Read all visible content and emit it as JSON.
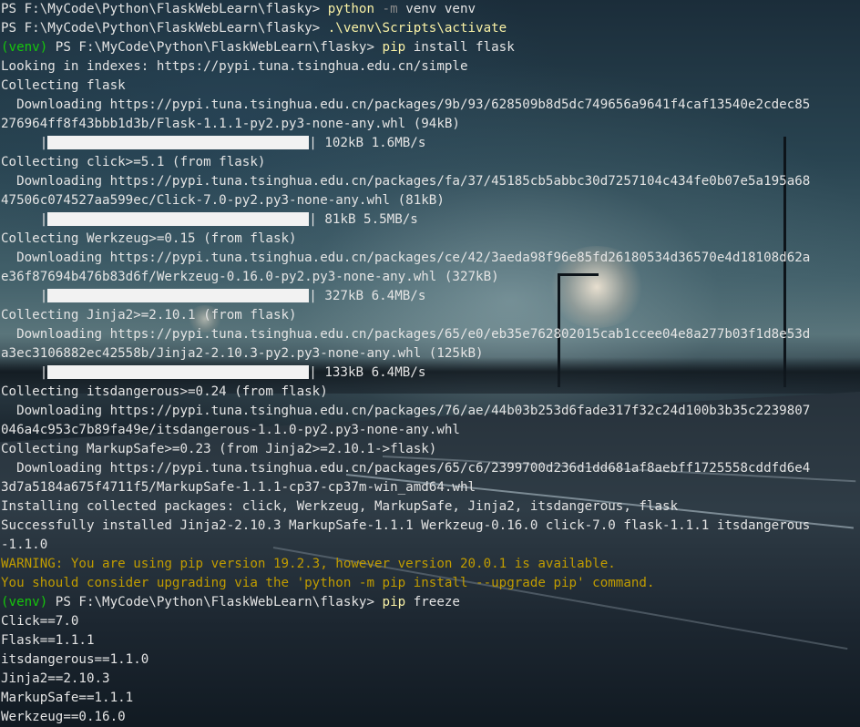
{
  "commands": {
    "c1": {
      "prompt": "PS F:\\MyCode\\Python\\FlaskWebLearn\\flasky> ",
      "cmd": "python",
      "flag": "-m",
      "args": "venv venv"
    },
    "c2": {
      "prompt": "PS F:\\MyCode\\Python\\FlaskWebLearn\\flasky> ",
      "cmd": ".\\venv\\Scripts\\activate"
    },
    "c3": {
      "venv": "(venv)",
      "prompt": " PS F:\\MyCode\\Python\\FlaskWebLearn\\flasky> ",
      "cmd": "pip",
      "args": " install flask"
    },
    "c4": {
      "venv": "(venv)",
      "prompt": " PS F:\\MyCode\\Python\\FlaskWebLearn\\flasky> ",
      "cmd": "pip",
      "args": " freeze"
    }
  },
  "install_output": {
    "l1": "Looking in indexes: https://pypi.tuna.tsinghua.edu.cn/simple",
    "l2": "Collecting flask",
    "l3": "  Downloading https://pypi.tuna.tsinghua.edu.cn/packages/9b/93/628509b8d5dc749656a9641f4caf13540e2cdec85",
    "l4": "276964ff8f43bbb1d3b/Flask-1.1.1-py2.py3-none-any.whl (94kB)",
    "p1": "| 102kB 1.6MB/s",
    "l5": "Collecting click>=5.1 (from flask)",
    "l6": "  Downloading https://pypi.tuna.tsinghua.edu.cn/packages/fa/37/45185cb5abbc30d7257104c434fe0b07e5a195a68",
    "l7": "47506c074527aa599ec/Click-7.0-py2.py3-none-any.whl (81kB)",
    "p2": "| 81kB 5.5MB/s",
    "l8": "Collecting Werkzeug>=0.15 (from flask)",
    "l9": "  Downloading https://pypi.tuna.tsinghua.edu.cn/packages/ce/42/3aeda98f96e85fd26180534d36570e4d18108d62a",
    "l10": "e36f87694b476b83d6f/Werkzeug-0.16.0-py2.py3-none-any.whl (327kB)",
    "p3": "| 327kB 6.4MB/s",
    "l11": "Collecting Jinja2>=2.10.1 (from flask)",
    "l12": "  Downloading https://pypi.tuna.tsinghua.edu.cn/packages/65/e0/eb35e762802015cab1ccee04e8a277b03f1d8e53d",
    "l13": "a3ec3106882ec42558b/Jinja2-2.10.3-py2.py3-none-any.whl (125kB)",
    "p4": "| 133kB 6.4MB/s",
    "l14": "Collecting itsdangerous>=0.24 (from flask)",
    "l15": "  Downloading https://pypi.tuna.tsinghua.edu.cn/packages/76/ae/44b03b253d6fade317f32c24d100b3b35c2239807",
    "l16": "046a4c953c7b89fa49e/itsdangerous-1.1.0-py2.py3-none-any.whl",
    "l17": "Collecting MarkupSafe>=0.23 (from Jinja2>=2.10.1->flask)",
    "l18": "  Downloading https://pypi.tuna.tsinghua.edu.cn/packages/65/c6/2399700d236d1dd681af8aebff1725558cddfd6e4",
    "l19": "3d7a5184a675f4711f5/MarkupSafe-1.1.1-cp37-cp37m-win_amd64.whl",
    "l20": "Installing collected packages: click, Werkzeug, MarkupSafe, Jinja2, itsdangerous, flask",
    "l21": "Successfully installed Jinja2-2.10.3 MarkupSafe-1.1.1 Werkzeug-0.16.0 click-7.0 flask-1.1.1 itsdangerous",
    "l22": "-1.1.0",
    "w1": "WARNING: You are using pip version 19.2.3, however version 20.0.1 is available.",
    "w2": "You should consider upgrading via the 'python -m pip install --upgrade pip' command."
  },
  "freeze_output": [
    "Click==7.0",
    "Flask==1.1.1",
    "itsdangerous==1.1.0",
    "Jinja2==2.10.3",
    "MarkupSafe==1.1.1",
    "Werkzeug==0.16.0"
  ],
  "progress": {
    "fraction": 1.0
  },
  "colors": {
    "prompt_venv": "#16c60c",
    "command": "#f9f1a5",
    "flag": "#8a8a8a",
    "warning": "#c19c00",
    "text": "#e4e4e4"
  }
}
